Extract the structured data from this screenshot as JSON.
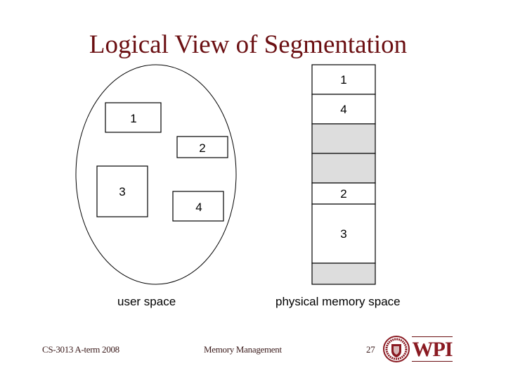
{
  "slide": {
    "title": "Logical View of Segmentation",
    "title_color": "#6B0F12"
  },
  "user_space": {
    "caption": "user space",
    "segments": [
      {
        "label": "1"
      },
      {
        "label": "2"
      },
      {
        "label": "3"
      },
      {
        "label": "4"
      }
    ]
  },
  "physical_memory": {
    "caption": "physical memory space",
    "blocks": [
      {
        "label": "1",
        "state": "allocated"
      },
      {
        "label": "4",
        "state": "allocated"
      },
      {
        "label": "",
        "state": "free"
      },
      {
        "label": "",
        "state": "free"
      },
      {
        "label": "2",
        "state": "allocated"
      },
      {
        "label": "3",
        "state": "allocated"
      },
      {
        "label": "",
        "state": "free"
      }
    ],
    "free_color": "#DDDDDD",
    "allocated_color": "#FFFFFF"
  },
  "footer": {
    "course": "CS-3013 A-term 2008",
    "topic": "Memory Management",
    "page_number": "27",
    "logo_text": "WPI"
  }
}
